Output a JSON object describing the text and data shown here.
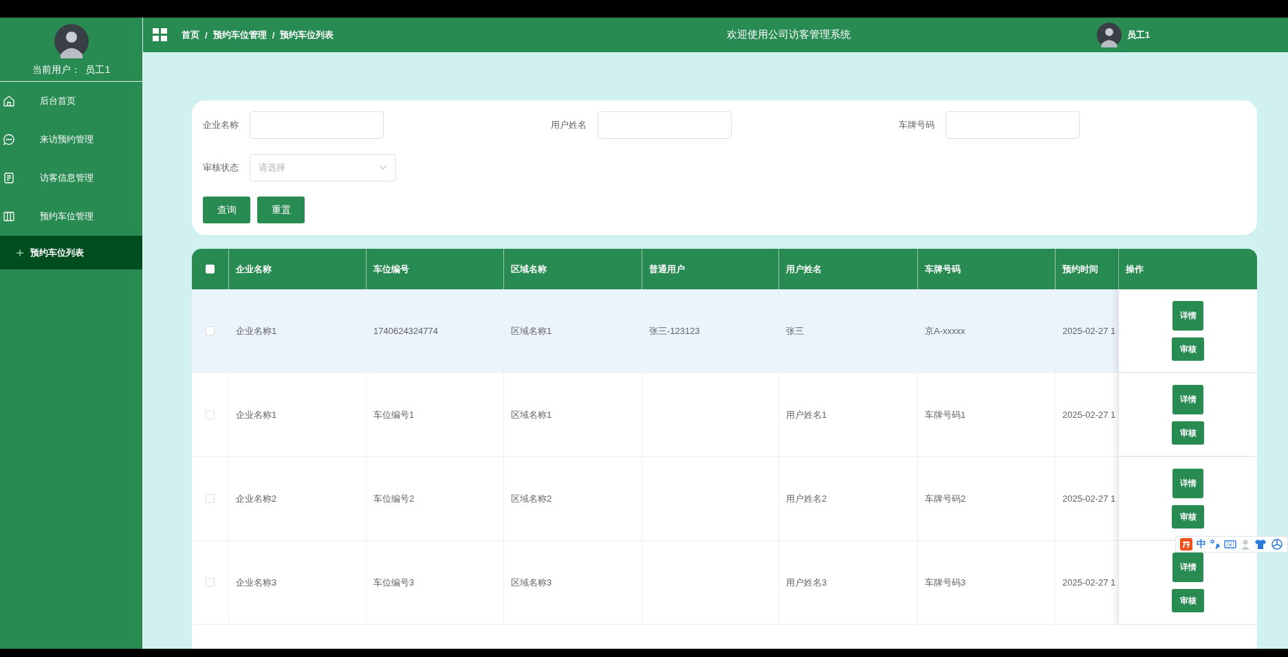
{
  "sidebar": {
    "current_user": "当前用户：  员工1",
    "items": [
      {
        "label": "后台首页",
        "kind": "home"
      },
      {
        "label": "来访预约管理",
        "kind": "chat"
      },
      {
        "label": "访客信息管理",
        "kind": "doc"
      },
      {
        "label": "预约车位管理",
        "kind": "columns",
        "expanded": true,
        "children": [
          {
            "label": "预约车位列表",
            "selected": true
          }
        ]
      }
    ]
  },
  "header": {
    "breadcrumb": [
      "首页",
      "预约车位管理",
      "预约车位列表"
    ],
    "separator": "/",
    "title": "欢迎使用公司访客管理系统",
    "user_name": "员工1"
  },
  "search": {
    "fields": [
      {
        "label": "企业名称",
        "kind": "input"
      },
      {
        "label": "用户姓名",
        "kind": "input"
      },
      {
        "label": "车牌号码",
        "kind": "input"
      },
      {
        "label": "审核状态",
        "kind": "select",
        "placeholder": "请选择"
      }
    ],
    "buttons": [
      "查询",
      "重置"
    ]
  },
  "table": {
    "select_all_checked": false,
    "columns": [
      "企业名称",
      "车位编号",
      "区域名称",
      "普通用户",
      "用户姓名",
      "车牌号码",
      "预约时间",
      "操作"
    ],
    "rows": [
      {
        "highlighted": true,
        "checked": false,
        "cells": [
          "企业名称1",
          "1740624324774",
          "区域名称1",
          "张三-123123",
          "张三",
          "京A-xxxxx",
          "2025-02-27 1"
        ],
        "actions": [
          "详情",
          "审核"
        ]
      },
      {
        "highlighted": false,
        "checked": false,
        "cells": [
          "企业名称1",
          "车位编号1",
          "区域名称1",
          "",
          "用户姓名1",
          "车牌号码1",
          "2025-02-27 1"
        ],
        "actions": [
          "详情",
          "审核"
        ]
      },
      {
        "highlighted": false,
        "checked": false,
        "cells": [
          "企业名称2",
          "车位编号2",
          "区域名称2",
          "",
          "用户姓名2",
          "车牌号码2",
          "2025-02-27 1"
        ],
        "actions": [
          "详情",
          "审核"
        ]
      },
      {
        "highlighted": false,
        "checked": false,
        "cells": [
          "企业名称3",
          "车位编号3",
          "区域名称3",
          "",
          "用户姓名3",
          "车牌号码3",
          "2025-02-27 1"
        ],
        "actions": [
          "详情",
          "审核"
        ]
      }
    ]
  },
  "ime_toolbar": {
    "mode": "中"
  }
}
